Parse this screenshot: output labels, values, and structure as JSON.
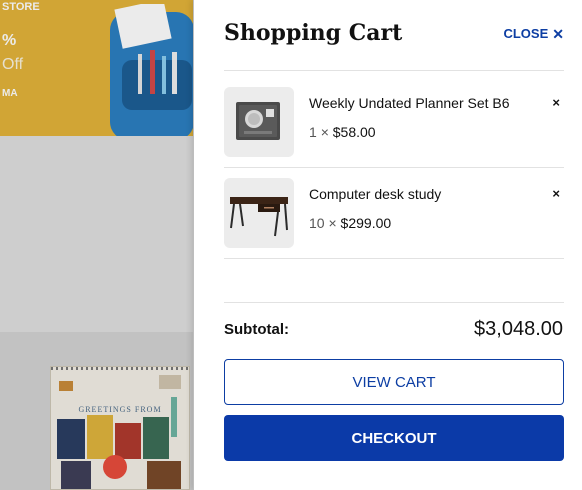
{
  "background": {
    "banner": {
      "text_store": "STORE",
      "text_percent": "%",
      "text_off": "Off",
      "text_ma": "MA"
    },
    "calendar": {
      "greeting": "GREETINGS FROM"
    }
  },
  "cart": {
    "title": "Shopping Cart",
    "close_label": "CLOSE",
    "items": [
      {
        "name": "Weekly Undated Planner Set B6",
        "quantity": "1",
        "times": "×",
        "price": "$58.00",
        "remove": "×",
        "icon": "planner-image"
      },
      {
        "name": "Computer desk study",
        "quantity": "10",
        "times": "×",
        "price": "$299.00",
        "remove": "×",
        "icon": "desk-image"
      }
    ],
    "subtotal_label": "Subtotal:",
    "subtotal_value": "$3,048.00",
    "view_cart_label": "VIEW CART",
    "checkout_label": "CHECKOUT"
  },
  "colors": {
    "accent": "#0b3aa8",
    "banner": "#e3b43a"
  }
}
